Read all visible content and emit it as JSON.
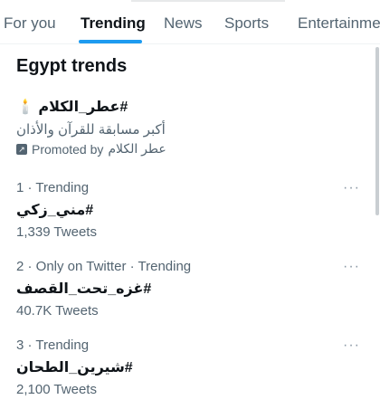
{
  "tabs": [
    {
      "label": "For you"
    },
    {
      "label": "Trending"
    },
    {
      "label": "News"
    },
    {
      "label": "Sports"
    },
    {
      "label": "Entertainment"
    }
  ],
  "heading": "Egypt trends",
  "promoted": {
    "hashtag": "#عطر_الكلام",
    "emoji": "🕯️",
    "description": "أكبر مسابقة للقرآن والأذان",
    "promoted_by_label": "Promoted by",
    "promoted_by_name": "عطر الكلام",
    "icon": "promoted-arrow-icon"
  },
  "trends": [
    {
      "meta": "1 · Trending",
      "hashtag": "#مني_زكي",
      "count": "1,339 Tweets"
    },
    {
      "meta": "2 · Only on Twitter · Trending",
      "hashtag": "#غزه_تحت_القصف",
      "count": "40.7K Tweets"
    },
    {
      "meta": "3 · Trending",
      "hashtag": "#شيرين_الطحان",
      "count": "2,100 Tweets"
    }
  ],
  "more_icon": "···"
}
